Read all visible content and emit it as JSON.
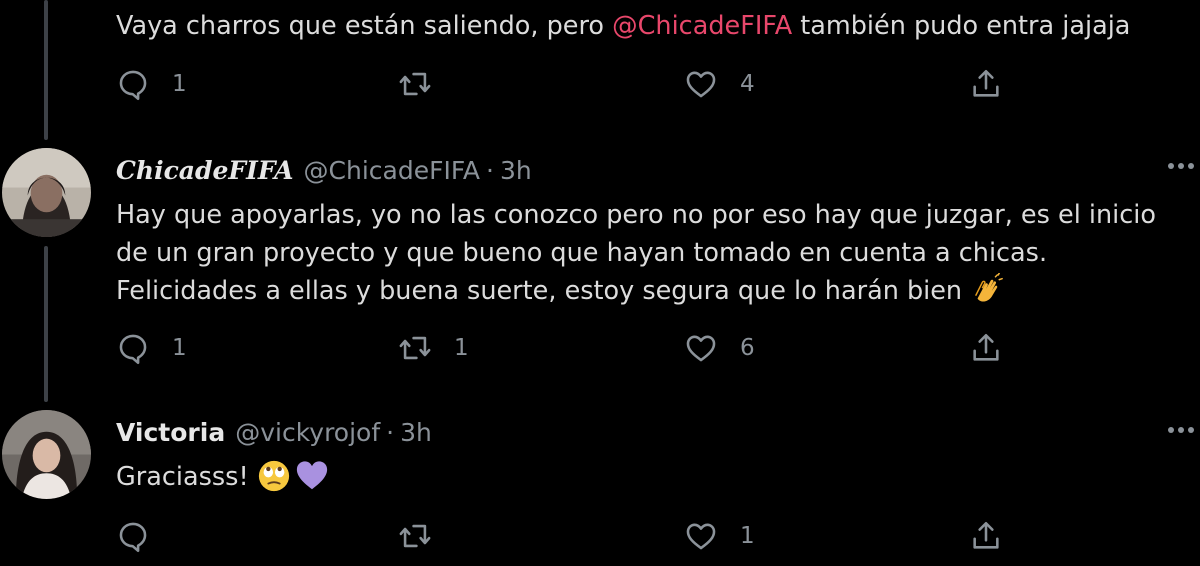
{
  "tweets": [
    {
      "text_before": "Vaya charros que están saliendo, pero ",
      "mention": "@ChicadeFIFA",
      "text_after": "  también pudo entra jajaja",
      "reply_count": "1",
      "retweet_count": "",
      "like_count": "4"
    },
    {
      "display_name": "ChicadeFIFA",
      "handle": "@ChicadeFIFA",
      "separator": "·",
      "time": "3h",
      "lines": [
        "Hay que apoyarlas, yo no las conozco pero no por eso hay que juzgar, es el inicio",
        "de un gran proyecto y que bueno que hayan tomado en cuenta a chicas.",
        "Felicidades a ellas y buena suerte, estoy segura que lo harán bien "
      ],
      "emoji": "clapping-hands-emoji",
      "reply_count": "1",
      "retweet_count": "1",
      "like_count": "6"
    },
    {
      "display_name": "Victoria",
      "handle": "@vickyrojof",
      "separator": "·",
      "time": "3h",
      "text": "Graciasss! ",
      "emojis": [
        "eye-roll-face-emoji",
        "purple-heart-emoji"
      ],
      "reply_count": "",
      "retweet_count": "",
      "like_count": "1"
    }
  ],
  "colors": {
    "background": "#000000",
    "mention": "#e8476b",
    "muted": "#8b9299",
    "thread_line": "#3d4147",
    "text": "#dcdcdc"
  }
}
